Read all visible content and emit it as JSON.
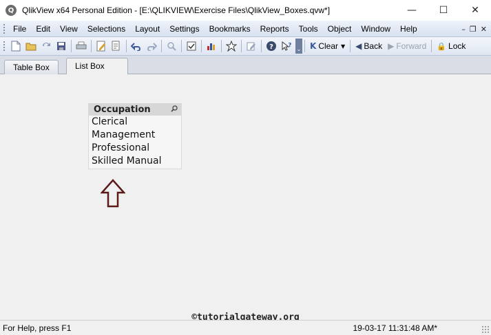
{
  "window": {
    "title": "QlikView x64 Personal Edition - [E:\\QLIKVIEW\\Exercise Files\\QlikView_Boxes.qvw*]",
    "app_icon_glyph": "Q",
    "minimize": "—",
    "maximize": "☐",
    "close": "✕"
  },
  "menu": {
    "items": [
      "File",
      "Edit",
      "View",
      "Selections",
      "Layout",
      "Settings",
      "Bookmarks",
      "Reports",
      "Tools",
      "Object",
      "Window",
      "Help"
    ],
    "mdi_minimize": "–",
    "mdi_restore": "❐",
    "mdi_close": "✕"
  },
  "toolbar": {
    "icons": [
      "new-icon",
      "open-icon",
      "reload-icon",
      "save-icon",
      "print-icon",
      "edit-script-icon",
      "edit-module-icon",
      "undo-icon",
      "redo-icon",
      "search-icon",
      "properties-icon",
      "chart-icon",
      "bookmark-star-icon",
      "edit-icon",
      "help-icon",
      "whats-this-icon"
    ],
    "overflow_glyph": "⌄",
    "clear_label": "Clear",
    "clear_icon": "K",
    "back_label": "Back",
    "back_icon": "◀",
    "forward_label": "Forward",
    "forward_icon": "▶",
    "lock_label": "Lock",
    "lock_icon": "🔒"
  },
  "tabs": [
    {
      "label": "Table Box",
      "active": false
    },
    {
      "label": "List Box",
      "active": true
    }
  ],
  "listbox": {
    "title": "Occupation",
    "search_icon": "🔍",
    "values": [
      "Clerical",
      "Management",
      "Professional",
      "Skilled Manual"
    ]
  },
  "annotation": {
    "arrow_color": "#5a1a1a"
  },
  "watermark": "©tutorialgateway.org",
  "status": {
    "help_text": "For Help, press F1",
    "timestamp": "19-03-17 11:31:48 AM*"
  }
}
